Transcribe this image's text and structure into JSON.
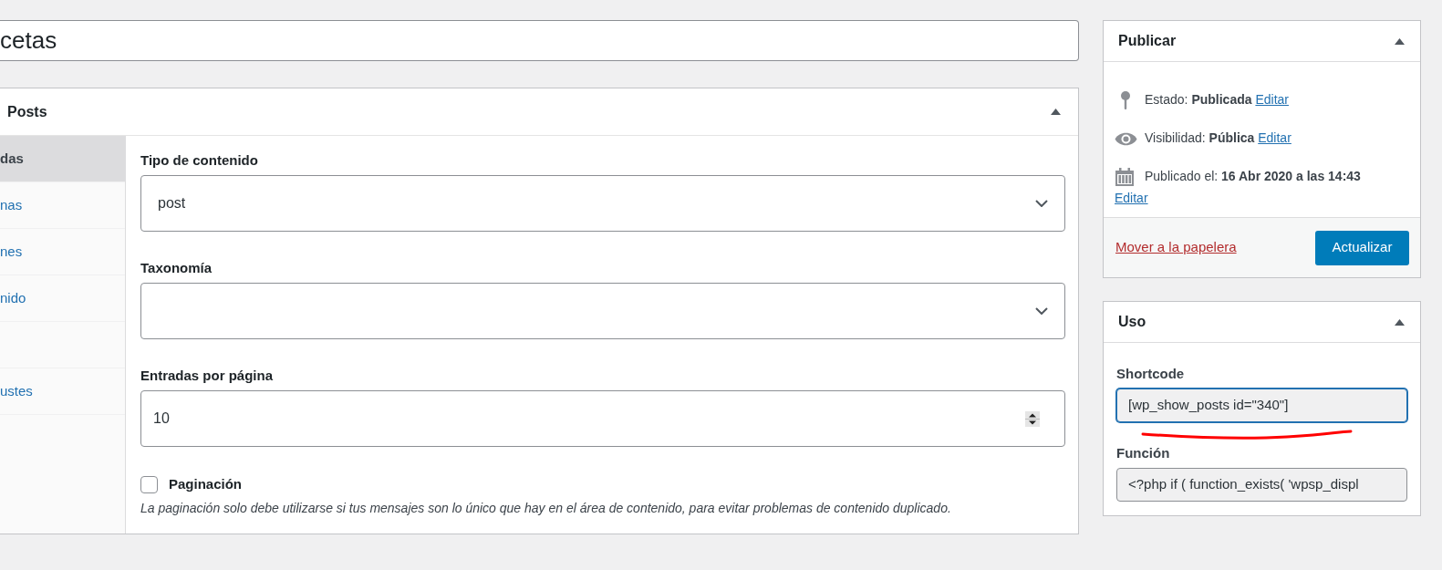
{
  "title_field": {
    "value": "cetas"
  },
  "main_box": {
    "title": "Posts",
    "expanded": true,
    "tabs": [
      {
        "label": "das",
        "selected": true
      },
      {
        "label": "nas",
        "selected": false
      },
      {
        "label": "nes",
        "selected": false
      },
      {
        "label": "nido",
        "selected": false
      },
      {
        "selected": false
      },
      {
        "label": "ustes",
        "selected": false
      }
    ],
    "fields": [
      {
        "kind": "select",
        "label": "Tipo de contenido",
        "value": "post"
      },
      {
        "kind": "select",
        "label": "Taxonomía"
      },
      {
        "kind": "number",
        "label": "Entradas por página",
        "value": "10"
      },
      {
        "kind": "checkbox",
        "label": "Paginación",
        "checked": false,
        "description": "La paginación solo debe utilizarse si tus mensajes son lo único que hay en el área de contenido, para evitar problemas de contenido duplicado."
      }
    ]
  },
  "publish_box": {
    "title": "Publicar",
    "expanded": true,
    "rows": [
      {
        "kind": "status",
        "text": "Estado: **Publicada**",
        "link": "Editar"
      },
      {
        "kind": "visibility",
        "text": "Visibilidad: **Pública**",
        "link": "Editar"
      },
      {
        "kind": "date",
        "text": "Publicado el: **16 Abr 2020 a las 14:43**",
        "link": "Editar"
      }
    ],
    "trash_link": "Mover a la papelera",
    "update_button": "Actualizar"
  },
  "usage_box": {
    "title": "Uso",
    "expanded": true,
    "fields": [
      {
        "label": "Shortcode",
        "value": "[wp_show_posts id=\"340\"]",
        "focused": true
      },
      {
        "label": "Función",
        "value": "<?php if ( function_exists( 'wpsp_displ",
        "focused": false
      }
    ]
  }
}
